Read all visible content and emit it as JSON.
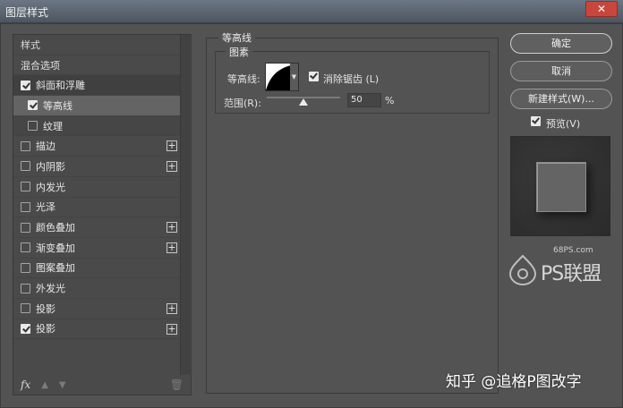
{
  "window": {
    "title": "图层样式",
    "close_label": "✕"
  },
  "left_panel": {
    "header": "样式",
    "blend_options": "混合选项",
    "items": [
      {
        "label": "斜面和浮雕",
        "checked": true,
        "plus": false
      },
      {
        "label": "等高线",
        "checked": true,
        "plus": false
      },
      {
        "label": "纹理",
        "checked": false,
        "plus": false
      },
      {
        "label": "描边",
        "checked": false,
        "plus": true
      },
      {
        "label": "内阴影",
        "checked": false,
        "plus": true
      },
      {
        "label": "内发光",
        "checked": false,
        "plus": false
      },
      {
        "label": "光泽",
        "checked": false,
        "plus": false
      },
      {
        "label": "颜色叠加",
        "checked": false,
        "plus": true
      },
      {
        "label": "渐变叠加",
        "checked": false,
        "plus": true
      },
      {
        "label": "图案叠加",
        "checked": false,
        "plus": false
      },
      {
        "label": "外发光",
        "checked": false,
        "plus": false
      },
      {
        "label": "投影",
        "checked": false,
        "plus": true
      },
      {
        "label": "投影",
        "checked": true,
        "plus": true
      }
    ],
    "bottom": {
      "fx": "fx",
      "up_arrow": "▲",
      "down_arrow": "▼",
      "trash": "🗑"
    }
  },
  "main": {
    "group_title": "等高线",
    "subgroup_title": "图素",
    "contour_label": "等高线:",
    "anti_alias_label": "消除锯齿 (L)",
    "anti_alias_checked": true,
    "range_label": "范围(R):",
    "range_value": "50",
    "range_unit": "%",
    "range_fraction": 0.5
  },
  "right": {
    "ok": "确定",
    "cancel": "取消",
    "new_style": "新建样式(W)...",
    "preview_label": "预览(V)",
    "preview_checked": true
  },
  "watermark": {
    "site": "68PS.com",
    "brand": "PS联盟",
    "zhihu": "知乎 @追格P图改字"
  },
  "colors": {
    "dialog_bg": "#535353",
    "panel_bg": "#4a4a4a",
    "selected_row": "#646464",
    "close_button": "#c8473d"
  }
}
